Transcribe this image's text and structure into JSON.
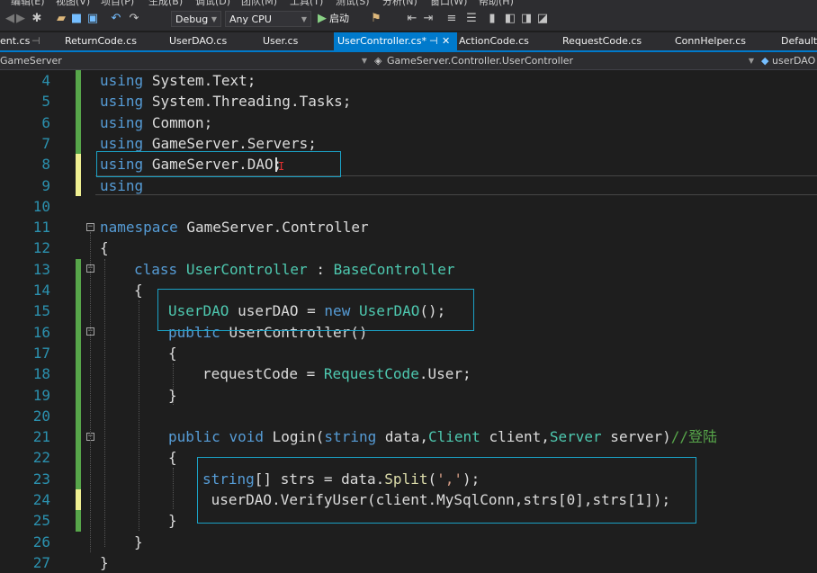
{
  "menu": {
    "items": [
      "编辑(E)",
      "视图(V)",
      "项目(P)",
      "生成(B)",
      "调试(D)",
      "团队(M)",
      "工具(T)",
      "测试(S)",
      "分析(N)",
      "窗口(W)",
      "帮助(H)"
    ]
  },
  "toolbar": {
    "config": "Debug",
    "platform": "Any CPU",
    "start_label": "启动"
  },
  "tabs": [
    {
      "label": "ent.cs"
    },
    {
      "label": "ReturnCode.cs"
    },
    {
      "label": "UserDAO.cs"
    },
    {
      "label": "User.cs"
    },
    {
      "label": "UserController.cs*",
      "active": true
    },
    {
      "label": "ActionCode.cs"
    },
    {
      "label": "RequestCode.cs"
    },
    {
      "label": "ConnHelper.cs"
    },
    {
      "label": "DefaultCo"
    }
  ],
  "navbar": {
    "project": "GameServer",
    "class": "GameServer.Controller.UserController",
    "member": "userDAO"
  },
  "code": {
    "line_numbers": [
      "4",
      "5",
      "6",
      "7",
      "8",
      "9",
      "10",
      "11",
      "12",
      "13",
      "14",
      "15",
      "16",
      "17",
      "18",
      "19",
      "20",
      "21",
      "22",
      "23",
      "24",
      "25",
      "26",
      "27"
    ],
    "using": "using",
    "u4": "System.Text;",
    "u5": "System.Threading.Tasks;",
    "u6": "Common;",
    "u7": "GameServer.Servers;",
    "u8": "GameServer.DAO;",
    "namespace_kw": "namespace",
    "namespace_name": "GameServer.Controller",
    "open_brace": "{",
    "close_brace": "}",
    "class_kw": "class",
    "class_name": "UserController",
    "colon": ":",
    "base_class": "BaseController",
    "l15_type": "UserDAO",
    "l15_var": "userDAO =",
    "l15_new": "new",
    "l15_ctor": "UserDAO",
    "l15_end": "();",
    "public_kw": "public",
    "ctor_name": "UserController",
    "ctor_parens": "()",
    "l18_left": "requestCode = ",
    "l18_type": "RequestCode",
    "l18_right": ".User;",
    "void_kw": "void",
    "method_name": "Login",
    "paren_open": "(",
    "string_kw": "string",
    "p1": " data,",
    "client_type": "Client",
    "p2": " client,",
    "server_type": "Server",
    "p3": " server)",
    "comment": "//登陆",
    "l23_kw": "string",
    "l23_rest1": "[] strs = data.",
    "l23_fn": "Split",
    "l23_rest2": "(",
    "l23_char": "','",
    "l23_rest3": ");",
    "l24": " userDAO.VerifyUser(client.MySqlConn,strs[0],strs[1]);"
  },
  "colors": {
    "keyword": "#569cd6",
    "type": "#4ec9b0",
    "line_number": "#2b91af",
    "highlight_box": "#1ba1c5",
    "saved_marker": "#57a64a",
    "unsaved_marker": "#efef91"
  }
}
